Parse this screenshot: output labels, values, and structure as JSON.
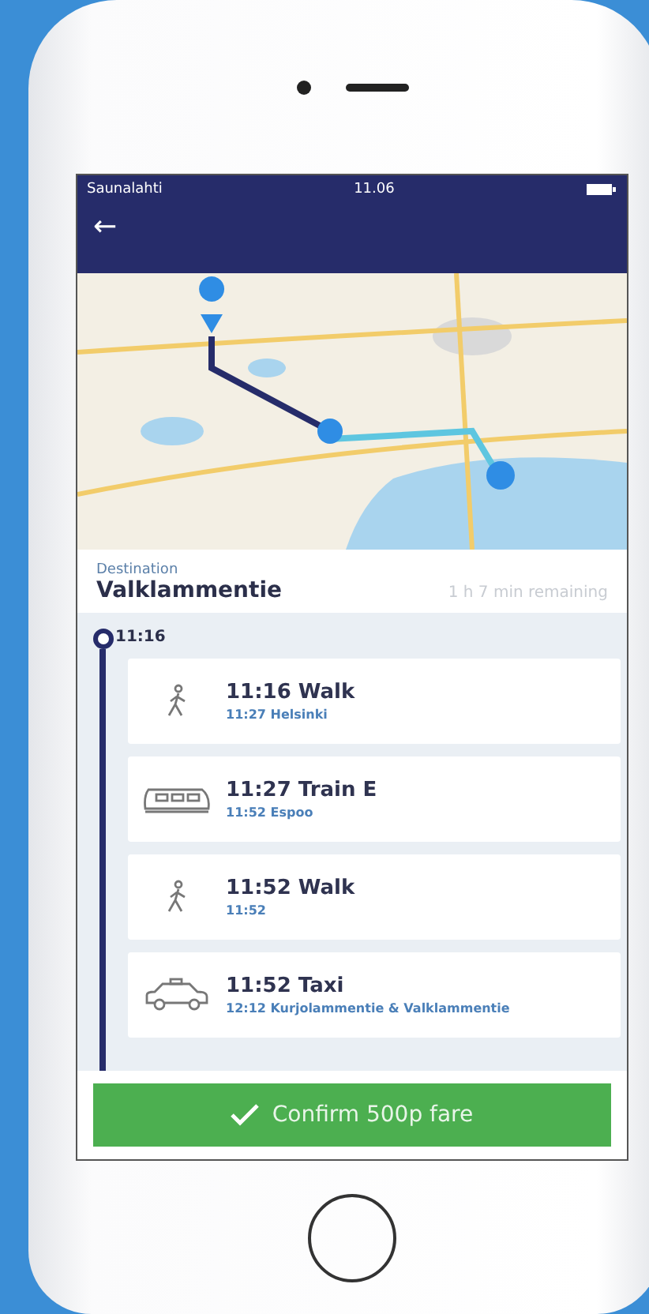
{
  "status_bar": {
    "carrier": "Saunalahti",
    "time": "11.06"
  },
  "header": {
    "back": "←"
  },
  "destination": {
    "label": "Destination",
    "name": "Valklammentie",
    "remaining": "1 h 7 min remaining"
  },
  "timeline": {
    "start": "11:16",
    "legs": [
      {
        "kind": "walk",
        "title": "11:16 Walk",
        "subtitle": "11:27 Helsinki"
      },
      {
        "kind": "train",
        "title": "11:27 Train E",
        "subtitle": "11:52 Espoo"
      },
      {
        "kind": "walk",
        "title": "11:52 Walk",
        "subtitle": "11:52"
      },
      {
        "kind": "taxi",
        "title": "11:52 Taxi",
        "subtitle": "12:12 Kurjolammentie & Valklammentie"
      }
    ]
  },
  "confirm_button": {
    "label": "Confirm 500p fare"
  }
}
